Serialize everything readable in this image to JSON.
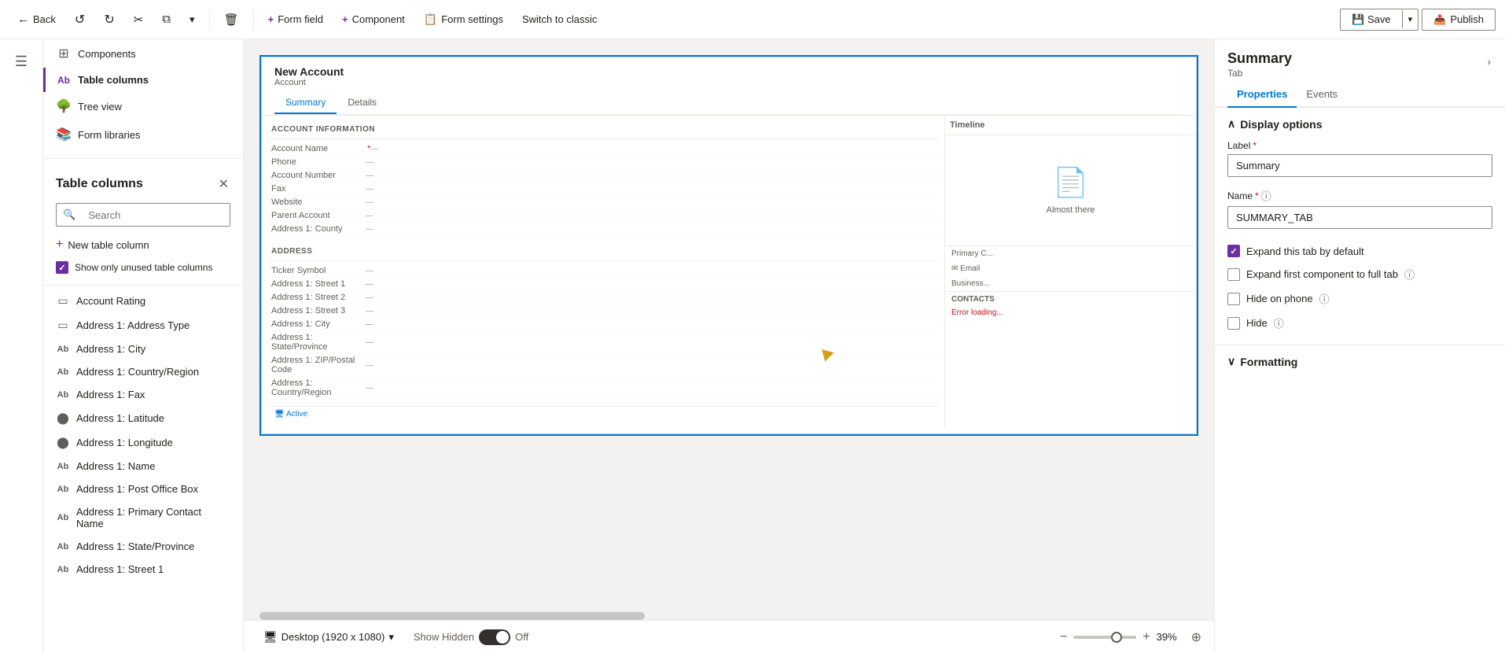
{
  "toolbar": {
    "back_label": "Back",
    "form_field_label": "Form field",
    "component_label": "Component",
    "form_settings_label": "Form settings",
    "switch_classic_label": "Switch to classic",
    "save_label": "Save",
    "publish_label": "Publish"
  },
  "left_sidebar": {
    "hamburger": "☰",
    "icons": [
      "⊞",
      "≡",
      "🌳",
      "📚"
    ]
  },
  "columns_panel": {
    "title": "Table columns",
    "search_placeholder": "Search",
    "new_column_label": "New table column",
    "show_unused_label": "Show only unused table columns",
    "nav_items": [
      {
        "label": "Components",
        "icon": "⊞"
      },
      {
        "label": "Table columns",
        "icon": "Ab",
        "active": true
      },
      {
        "label": "Tree view",
        "icon": "🌳"
      },
      {
        "label": "Form libraries",
        "icon": "📚"
      }
    ],
    "columns": [
      {
        "name": "Account Rating",
        "icon": "▭",
        "type": "text"
      },
      {
        "name": "Address 1: Address Type",
        "icon": "▭",
        "type": "text"
      },
      {
        "name": "Address 1: City",
        "icon": "Ab",
        "type": "text"
      },
      {
        "name": "Address 1: Country/Region",
        "icon": "Ab",
        "type": "text"
      },
      {
        "name": "Address 1: Fax",
        "icon": "Ab",
        "type": "text",
        "has_more": true
      },
      {
        "name": "Address 1: Latitude",
        "icon": "⬤",
        "type": "number"
      },
      {
        "name": "Address 1: Longitude",
        "icon": "⬤",
        "type": "number"
      },
      {
        "name": "Address 1: Name",
        "icon": "Ab",
        "type": "text"
      },
      {
        "name": "Address 1: Post Office Box",
        "icon": "Ab",
        "type": "text"
      },
      {
        "name": "Address 1: Primary Contact Name",
        "icon": "Ab",
        "type": "text"
      },
      {
        "name": "Address 1: State/Province",
        "icon": "Ab",
        "type": "text"
      },
      {
        "name": "Address 1: Street 1",
        "icon": "Ab",
        "type": "text"
      }
    ]
  },
  "form_preview": {
    "title": "New Account",
    "subtitle": "Account",
    "tabs": [
      "Summary",
      "Details"
    ],
    "active_tab": "Summary",
    "sections": {
      "account_info": {
        "header": "ACCOUNT INFORMATION",
        "fields": [
          {
            "label": "Account Name",
            "required": true,
            "value": "..."
          },
          {
            "label": "Phone",
            "value": "..."
          },
          {
            "label": "Account Number",
            "value": "..."
          },
          {
            "label": "Fax",
            "value": "..."
          },
          {
            "label": "Website",
            "value": "..."
          },
          {
            "label": "Parent Account",
            "value": "..."
          },
          {
            "label": "Address 1: County",
            "value": "..."
          }
        ]
      },
      "address": {
        "header": "ADDRESS",
        "fields": [
          {
            "label": "Ticker Symbol",
            "value": "..."
          },
          {
            "label": "Address 1: Street 1",
            "value": "..."
          },
          {
            "label": "Address 1: Street 2",
            "value": "..."
          },
          {
            "label": "Address 1: Street 3",
            "value": "..."
          },
          {
            "label": "Address 1: City",
            "value": "..."
          },
          {
            "label": "Address 1: State/Province",
            "value": "..."
          },
          {
            "label": "Address 1: ZIP/Postal Code",
            "value": "..."
          },
          {
            "label": "Address 1: Country/Region",
            "value": "..."
          }
        ]
      },
      "timeline": "Timeline",
      "almost_there": "Almost there",
      "contacts_header": "CONTACTS",
      "active_label": "Active"
    }
  },
  "bottom_bar": {
    "desktop_label": "Desktop (1920 x 1080)",
    "show_hidden_label": "Show Hidden",
    "off_label": "Off",
    "zoom_level": "39%"
  },
  "right_panel": {
    "title": "Summary",
    "subtitle": "Tab",
    "tabs": [
      "Properties",
      "Events"
    ],
    "active_tab": "Properties",
    "expand_btn": "›",
    "display_options": {
      "title": "Display options",
      "label_field_label": "Label",
      "label_required": true,
      "label_value": "Summary",
      "name_field_label": "Name",
      "name_required": true,
      "name_info": true,
      "name_value": "SUMMARY_TAB",
      "expand_tab_label": "Expand this tab by default",
      "expand_tab_checked": true,
      "expand_full_label": "Expand first component to full tab",
      "expand_full_info": true,
      "expand_full_checked": false,
      "hide_phone_label": "Hide on phone",
      "hide_phone_info": true,
      "hide_phone_checked": false,
      "hide_label": "Hide",
      "hide_info": true,
      "hide_checked": false
    },
    "formatting": {
      "title": "Formatting"
    }
  }
}
